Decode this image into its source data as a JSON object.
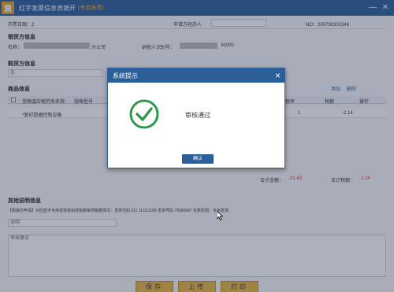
{
  "window": {
    "logo": "票",
    "title": "红字发票信息表填开",
    "title_tag": "(专用发票)",
    "minimize": "—",
    "close": "✕"
  },
  "header": {
    "date_label": "开票日期：",
    "date_value": "2",
    "applicant_label": "申请方经办人",
    "no_label": "NO：200730202346"
  },
  "seller": {
    "section": "销货方信息",
    "name_label": "名称：",
    "name_value": "分公司",
    "tax_label": "纳税人识别号：",
    "tax_value": "30000"
  },
  "buyer": {
    "section": "购货方信息",
    "name_value": "东"
  },
  "goods": {
    "section": "商品信息",
    "link_add": "添加",
    "link_delete": "删除",
    "headers": [
      "货物或应税劳务名称",
      "规格型号",
      "税率",
      "税额",
      "操作"
    ],
    "row": {
      "name": "*复印数据控制设备",
      "rate": "1",
      "tax": "-2.14"
    },
    "total_amount_label": "合计金额：",
    "total_amount": "-21.43",
    "total_tax_label": "合计税额：",
    "total_tax": "-2.14"
  },
  "notes": {
    "section": "其他说明信息",
    "reason": "【购销方申请】对应蓝字专用发票抵扣增值税销项税额情况：发票代码 011 111111108 发票号码 79099987 负数原因：专用发票",
    "input1_placeholder": "说明",
    "input2_placeholder": "审核建议"
  },
  "buttons": {
    "save": "保存",
    "upload": "上传",
    "print": "打印"
  },
  "dialog": {
    "title": "系统提示",
    "close": "×",
    "message": "审核通过",
    "ok": "确认"
  },
  "colors": {
    "primary": "#2a5f9a",
    "success": "#2e9a4a",
    "button": "#e7b53e",
    "negative": "#d03030"
  }
}
